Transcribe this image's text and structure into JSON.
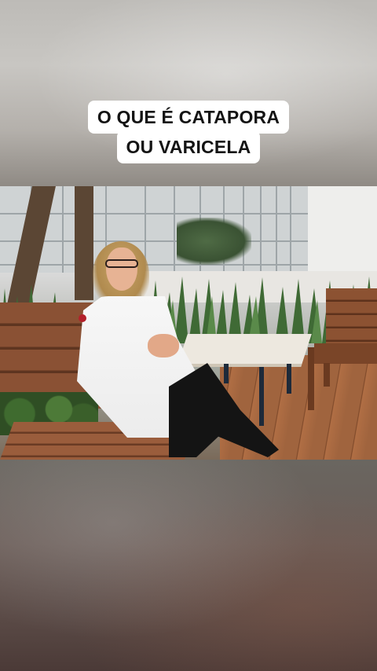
{
  "caption": {
    "line1": "O QUE É CATAPORA",
    "line2": "OU VARICELA"
  },
  "colors": {
    "caption_background": "#ffffff",
    "caption_text": "#141414",
    "coat": "#f7f7f7",
    "bench_wood": "#8a5134"
  },
  "video": {
    "scene": "video-frame"
  }
}
